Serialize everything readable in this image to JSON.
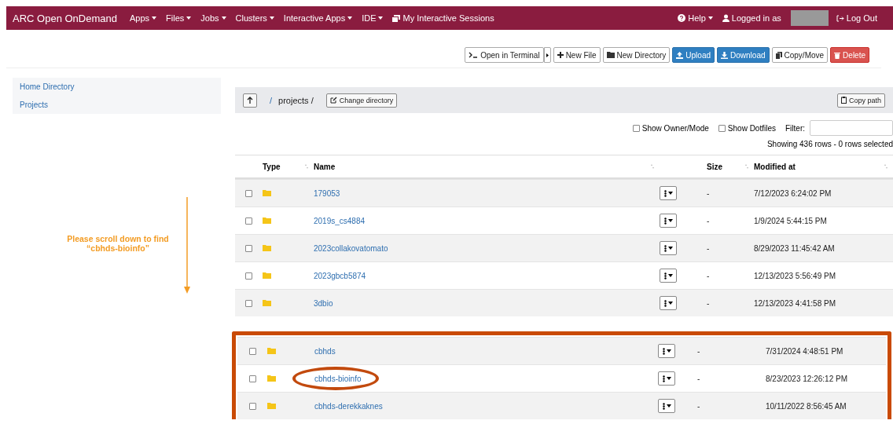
{
  "navbar": {
    "brand": "ARC Open OnDemand",
    "menus": [
      {
        "label": "Apps",
        "kind": "dropdown"
      },
      {
        "label": "Files",
        "kind": "dropdown"
      },
      {
        "label": "Jobs",
        "kind": "dropdown"
      },
      {
        "label": "Clusters",
        "kind": "dropdown"
      },
      {
        "label": "Interactive Apps",
        "kind": "dropdown"
      },
      {
        "label": "IDE",
        "kind": "dropdown"
      },
      {
        "label": "My Interactive Sessions",
        "kind": "link"
      }
    ],
    "help": "Help",
    "user_prefix": "Logged in as",
    "logout": "Log Out"
  },
  "toolbar": [
    {
      "label": "Open in Terminal",
      "kind": "terminal"
    },
    {
      "label": "New File",
      "kind": "plain"
    },
    {
      "label": "New Directory",
      "kind": "plain"
    },
    {
      "label": "Upload",
      "kind": "primary"
    },
    {
      "label": "Download",
      "kind": "primary"
    },
    {
      "label": "Copy/Move",
      "kind": "plain"
    },
    {
      "label": "Delete",
      "kind": "danger"
    }
  ],
  "sidebar": {
    "items": [
      "Home Directory",
      "Projects"
    ]
  },
  "path": {
    "separator": "/",
    "segment": "projects /",
    "change": "Change directory",
    "copy": "Copy path"
  },
  "filters": {
    "options": [
      {
        "label": "Show Owner/Mode",
        "checked": false
      },
      {
        "label": "Show Dotfiles",
        "checked": false
      }
    ],
    "filter_label": "Filter:"
  },
  "summary": "Showing 436 rows - 0 rows selected",
  "table": {
    "columns": [
      "Type",
      "Name",
      "Size",
      "Modified at"
    ],
    "rows": [
      {
        "name": "179053",
        "size": "-",
        "modified": "7/12/2023 6:24:02 PM",
        "checked": false
      },
      {
        "name": "2019s_cs4884",
        "size": "-",
        "modified": "1/9/2024 5:44:15 PM",
        "checked": false
      },
      {
        "name": "2023collakovatomato",
        "size": "-",
        "modified": "8/29/2023 11:45:42 AM",
        "checked": false
      },
      {
        "name": "2023gbcb5874",
        "size": "-",
        "modified": "12/13/2023 5:56:49 PM",
        "checked": false
      },
      {
        "name": "3dbio",
        "size": "-",
        "modified": "12/13/2023 4:41:58 PM",
        "checked": false
      }
    ],
    "later_rows": [
      {
        "name": "cbhds",
        "size": "-",
        "modified": "7/31/2024 4:48:51 PM",
        "checked": false,
        "circled": false
      },
      {
        "name": "cbhds-bioinfo",
        "size": "-",
        "modified": "8/23/2023 12:26:12 PM",
        "checked": false,
        "circled": true
      },
      {
        "name": "cbhds-derekkaknes",
        "size": "-",
        "modified": "10/11/2022 8:56:45 AM",
        "checked": false,
        "circled": false
      }
    ]
  },
  "annotation": {
    "note": "Please scroll down to find “cbhds-bioinfo”"
  }
}
